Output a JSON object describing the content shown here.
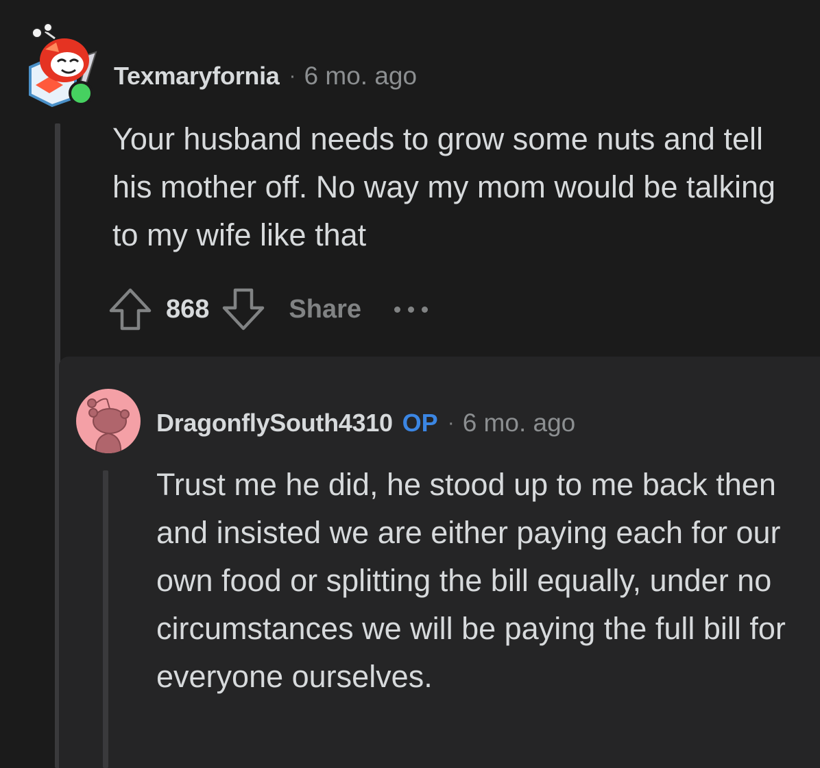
{
  "comment": {
    "author": "Texmaryfornia",
    "separator": "·",
    "time": "6 mo. ago",
    "body": "Your husband needs to grow some nuts and tell his mother off. No way my mom would be talking to my wife like that",
    "votes": "868",
    "share_label": "Share",
    "avatar_icon": "snoo-avatar-red-helmet-icon",
    "online_status_color": "#46d160",
    "upvote_icon": "upvote-arrow-icon",
    "downvote_icon": "downvote-arrow-icon",
    "more_icon": "more-options-icon"
  },
  "reply": {
    "author": "DragonflySouth4310",
    "op_badge": "OP",
    "separator": "·",
    "time": "6 mo. ago",
    "body": "Trust me he did, he stood up to me back then and insisted we are either paying each for our own food or splitting the bill equally, under no circumstances we will be paying the full bill for everyone ourselves.",
    "avatar_icon": "default-snoo-avatar-icon",
    "avatar_bg_color": "#f4a0a6"
  },
  "colors": {
    "background": "#1b1b1b",
    "reply_background": "#252526",
    "text": "#d7dadc",
    "muted": "#818384",
    "op_accent": "#3b86e3"
  }
}
